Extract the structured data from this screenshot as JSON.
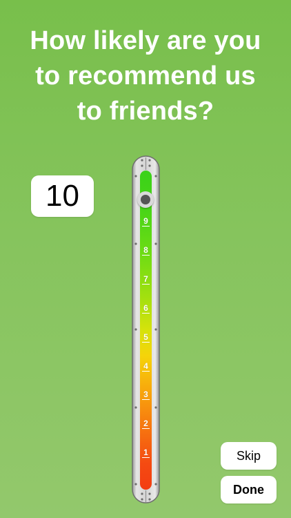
{
  "question": {
    "line1": "How likely are you",
    "line2": "to recommend us",
    "line3": "to friends?"
  },
  "rating": {
    "display_value": "10",
    "selected_value": 10,
    "min": 1,
    "max": 10,
    "tick_labels": [
      "9",
      "8",
      "7",
      "6",
      "5",
      "4",
      "3",
      "2",
      "1"
    ]
  },
  "buttons": {
    "skip_label": "Skip",
    "done_label": "Done"
  },
  "colors": {
    "background_top": "#78bf4b",
    "background_bottom": "#93c86c",
    "scale_top": "#3bd219",
    "scale_bottom": "#f33d12"
  },
  "icons": {
    "slider_knob": "slider-knob-icon"
  }
}
